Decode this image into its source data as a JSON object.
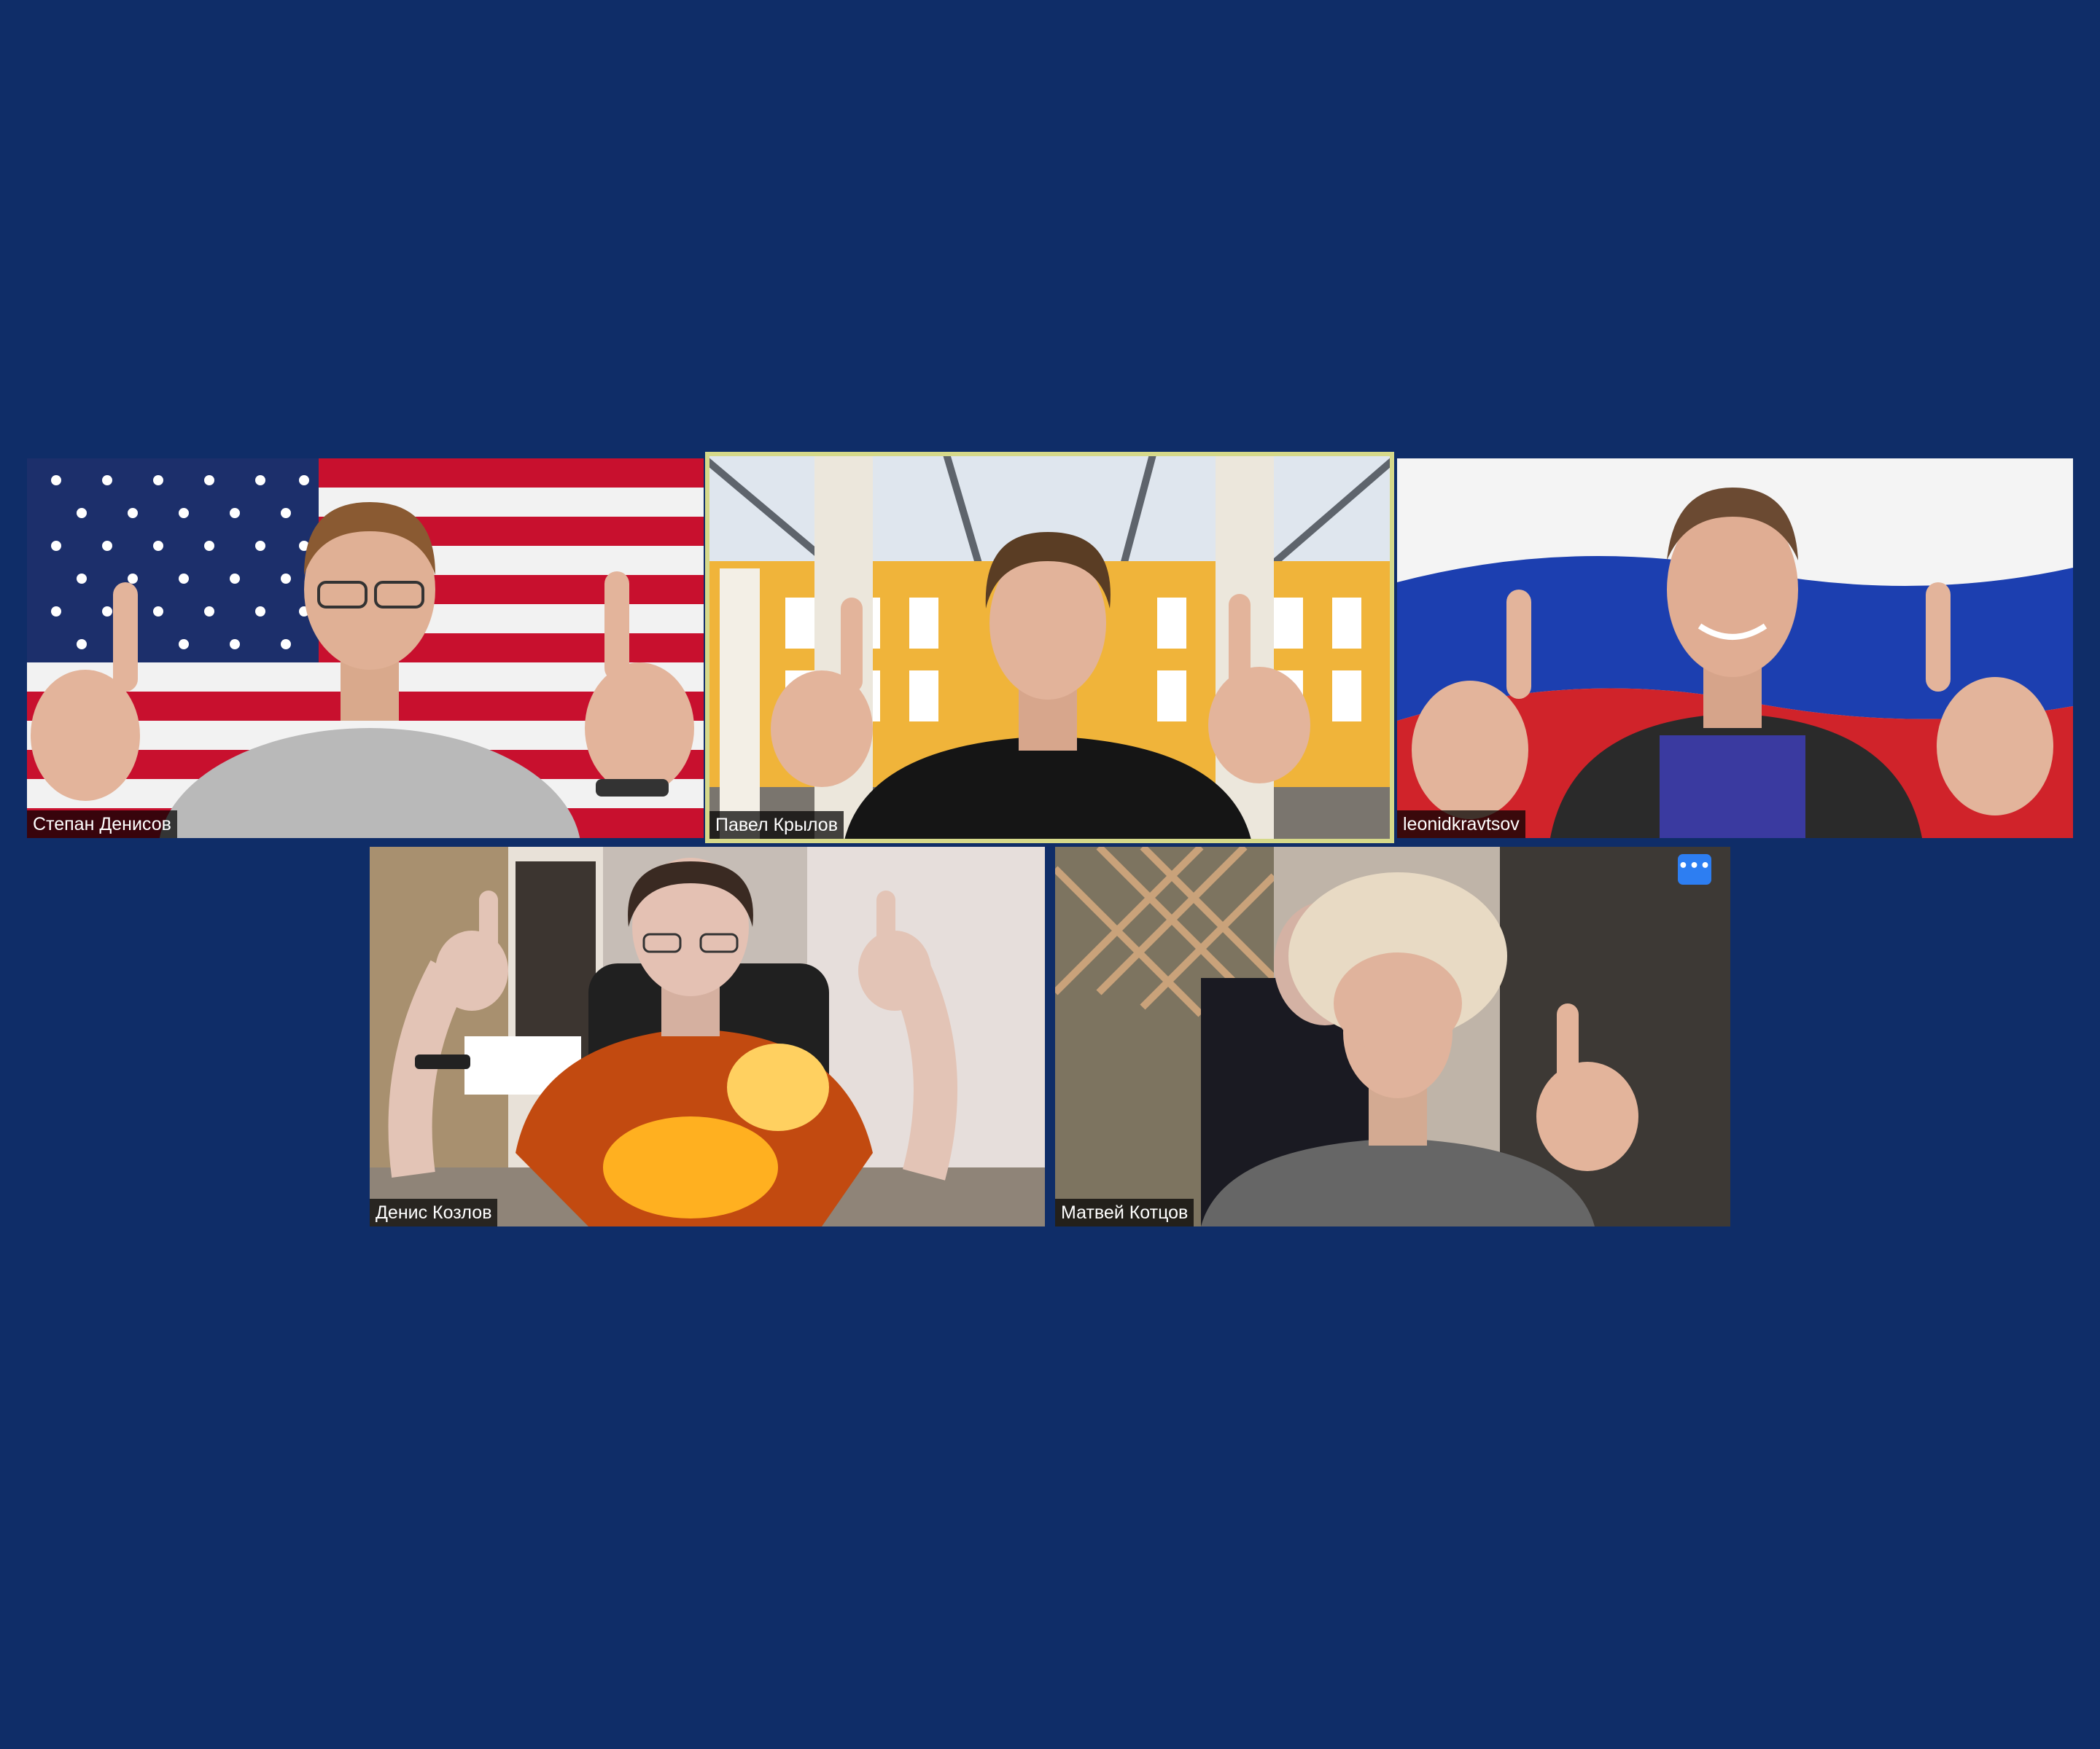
{
  "app": {
    "background_color": "#0f2d68",
    "active_speaker_color": "#d6d98a",
    "accent_color": "#2d7ef2"
  },
  "participants": [
    {
      "name": "Степан Денисов",
      "background": "us-flag",
      "active_speaker": false
    },
    {
      "name": "Павел Крылов",
      "background": "atrium-yellow-building",
      "active_speaker": true
    },
    {
      "name": "leonidkravtsov",
      "background": "russian-flag",
      "active_speaker": false
    },
    {
      "name": "Денис Козлов",
      "background": "room",
      "active_speaker": false
    },
    {
      "name": "Матвей Котцов",
      "background": "room-lattice",
      "active_speaker": false,
      "menu_icon": "more-icon",
      "menu_label": "•••"
    }
  ]
}
